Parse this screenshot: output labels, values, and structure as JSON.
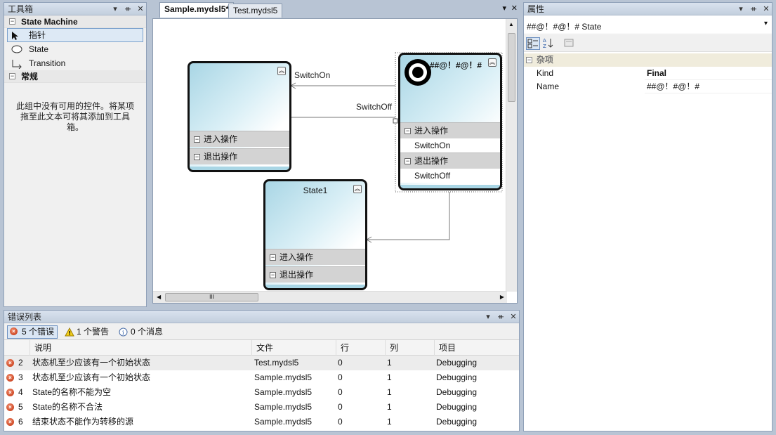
{
  "toolbox": {
    "title": "工具箱",
    "group1": "State Machine",
    "items": [
      "指针",
      "State",
      "Transition"
    ],
    "group2": "常规",
    "empty_note": "此组中没有可用的控件。将某项拖至此文本可将其添加到工具箱。"
  },
  "editor": {
    "tabs": [
      "Sample.mydsl5*",
      "Test.mydsl5"
    ],
    "states": [
      {
        "name": "",
        "entry": "进入操作",
        "exit": "退出操作"
      },
      {
        "name": "##@！#@！#",
        "entry": "进入操作",
        "entry_item": "SwitchOn",
        "exit": "退出操作",
        "exit_item": "SwitchOff"
      },
      {
        "name": "State1",
        "entry": "进入操作",
        "exit": "退出操作"
      }
    ],
    "transitions": [
      "SwitchOn",
      "SwitchOff"
    ],
    "hscroll_grip": "III"
  },
  "properties": {
    "title": "属性",
    "object_selector": "##@！#@！# State",
    "category": "杂项",
    "rows": [
      {
        "key": "Kind",
        "value": "Final"
      },
      {
        "key": "Name",
        "value": "##@！#@！#"
      }
    ]
  },
  "error_list": {
    "title": "错误列表",
    "filters": [
      "5 个错误",
      "1 个警告",
      "0 个消息"
    ],
    "columns": [
      "说明",
      "文件",
      "行",
      "列",
      "项目"
    ],
    "rows": [
      {
        "num": "2",
        "desc": "状态机至少应该有一个初始状态",
        "file": "Test.mydsl5",
        "line": "0",
        "col": "1",
        "project": "Debugging"
      },
      {
        "num": "3",
        "desc": "状态机至少应该有一个初始状态",
        "file": "Sample.mydsl5",
        "line": "0",
        "col": "1",
        "project": "Debugging"
      },
      {
        "num": "4",
        "desc": "State的名称不能为空",
        "file": "Sample.mydsl5",
        "line": "0",
        "col": "1",
        "project": "Debugging"
      },
      {
        "num": "5",
        "desc": "State的名称不合法",
        "file": "Sample.mydsl5",
        "line": "0",
        "col": "1",
        "project": "Debugging"
      },
      {
        "num": "6",
        "desc": "结束状态不能作为转移的源",
        "file": "Sample.mydsl5",
        "line": "0",
        "col": "1",
        "project": "Debugging"
      }
    ]
  },
  "window_buttons": {
    "dropdown": "▾",
    "pin": "ᚑ",
    "close": "✕"
  },
  "colors": {
    "state_gradient": "#a9d6e5",
    "section_bg": "#d3d3d3",
    "panel_border": "#8fa0b8"
  }
}
